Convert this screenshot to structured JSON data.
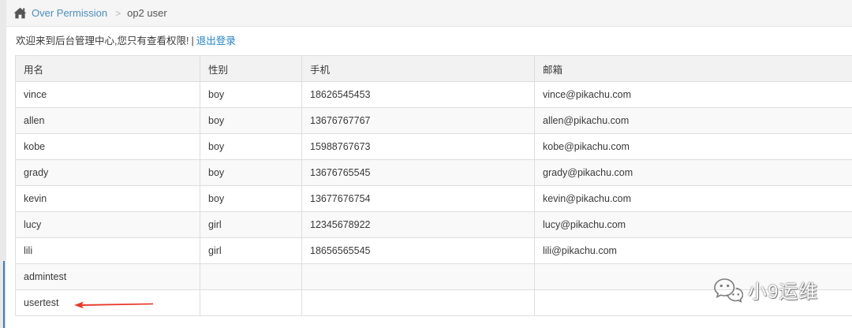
{
  "breadcrumb": {
    "parent": "Over Permission",
    "separator": ">",
    "current": "op2 user"
  },
  "welcome": {
    "message": "欢迎来到后台管理中心,您只有查看权限!",
    "divider": "|",
    "logout": "退出登录"
  },
  "table": {
    "headers": [
      "用名",
      "性别",
      "手机",
      "邮箱"
    ],
    "rows": [
      [
        "vince",
        "boy",
        "18626545453",
        "vince@pikachu.com"
      ],
      [
        "allen",
        "boy",
        "13676767767",
        "allen@pikachu.com"
      ],
      [
        "kobe",
        "boy",
        "15988767673",
        "kobe@pikachu.com"
      ],
      [
        "grady",
        "boy",
        "13676765545",
        "grady@pikachu.com"
      ],
      [
        "kevin",
        "boy",
        "13677676754",
        "kevin@pikachu.com"
      ],
      [
        "lucy",
        "girl",
        "12345678922",
        "lucy@pikachu.com"
      ],
      [
        "lili",
        "girl",
        "18656565545",
        "lili@pikachu.com"
      ],
      [
        "admintest",
        "",
        "",
        ""
      ],
      [
        "usertest",
        "",
        "",
        ""
      ]
    ]
  },
  "annotation": {
    "arrow_color": "#e8392b"
  },
  "watermark": {
    "text": "小9运维",
    "icon": "wechat-icon"
  },
  "colors": {
    "link": "#4c8fbd",
    "logout": "#2283c5",
    "marker": "#3a7ab8"
  }
}
